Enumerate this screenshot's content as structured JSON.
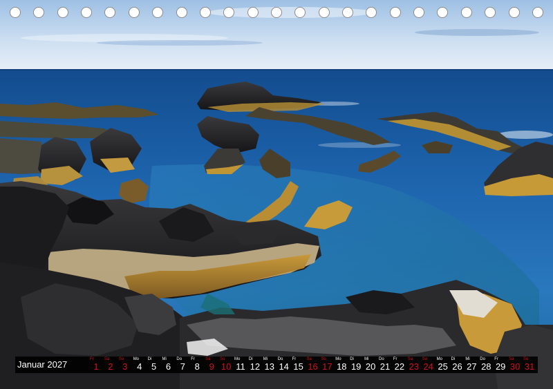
{
  "calendar": {
    "month_label": "Januar 2027",
    "weekend_color": "#d4111a",
    "days": [
      {
        "dn": "Fr",
        "d": "1",
        "weekend": true
      },
      {
        "dn": "Sa",
        "d": "2",
        "weekend": true
      },
      {
        "dn": "So",
        "d": "3",
        "weekend": true
      },
      {
        "dn": "Mo",
        "d": "4",
        "weekend": false
      },
      {
        "dn": "Di",
        "d": "5",
        "weekend": false
      },
      {
        "dn": "Mi",
        "d": "6",
        "weekend": false
      },
      {
        "dn": "Do",
        "d": "7",
        "weekend": false
      },
      {
        "dn": "Fr",
        "d": "8",
        "weekend": false
      },
      {
        "dn": "Sa",
        "d": "9",
        "weekend": true
      },
      {
        "dn": "So",
        "d": "10",
        "weekend": true
      },
      {
        "dn": "Mo",
        "d": "11",
        "weekend": false
      },
      {
        "dn": "Di",
        "d": "12",
        "weekend": false
      },
      {
        "dn": "Mi",
        "d": "13",
        "weekend": false
      },
      {
        "dn": "Do",
        "d": "14",
        "weekend": false
      },
      {
        "dn": "Fr",
        "d": "15",
        "weekend": false
      },
      {
        "dn": "Sa",
        "d": "16",
        "weekend": true
      },
      {
        "dn": "So",
        "d": "17",
        "weekend": true
      },
      {
        "dn": "Mo",
        "d": "18",
        "weekend": false
      },
      {
        "dn": "Di",
        "d": "19",
        "weekend": false
      },
      {
        "dn": "Mi",
        "d": "20",
        "weekend": false
      },
      {
        "dn": "Do",
        "d": "21",
        "weekend": false
      },
      {
        "dn": "Fr",
        "d": "22",
        "weekend": false
      },
      {
        "dn": "Sa",
        "d": "23",
        "weekend": true
      },
      {
        "dn": "So",
        "d": "24",
        "weekend": true
      },
      {
        "dn": "Mo",
        "d": "25",
        "weekend": false
      },
      {
        "dn": "Di",
        "d": "26",
        "weekend": false
      },
      {
        "dn": "Mi",
        "d": "27",
        "weekend": false
      },
      {
        "dn": "Do",
        "d": "28",
        "weekend": false
      },
      {
        "dn": "Fr",
        "d": "29",
        "weekend": false
      },
      {
        "dn": "Sa",
        "d": "30",
        "weekend": true
      },
      {
        "dn": "So",
        "d": "31",
        "weekend": true
      }
    ]
  }
}
